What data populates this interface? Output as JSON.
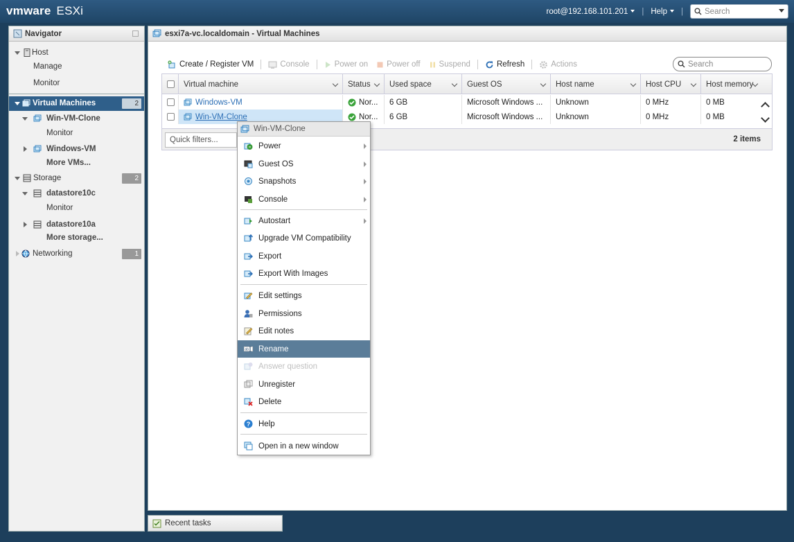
{
  "app": {
    "brand_vm": "vmware",
    "brand_product": "ESXi"
  },
  "topbar": {
    "user": "root@192.168.101.201",
    "help": "Help",
    "search_placeholder": "Search"
  },
  "navigator": {
    "title": "Navigator",
    "host": "Host",
    "manage": "Manage",
    "monitor": "Monitor",
    "vms": {
      "label": "Virtual Machines",
      "count": "2"
    },
    "vm1": "Win-VM-Clone",
    "vm1_monitor": "Monitor",
    "vm2": "Windows-VM",
    "more_vms": "More VMs...",
    "storage": {
      "label": "Storage",
      "count": "2"
    },
    "ds1": "datastore10c",
    "ds1_monitor": "Monitor",
    "ds2": "datastore10a",
    "more_storage": "More storage...",
    "networking": {
      "label": "Networking",
      "count": "1"
    }
  },
  "main": {
    "title": "esxi7a-vc.localdomain - Virtual Machines",
    "toolbar": {
      "create": "Create / Register VM",
      "console": "Console",
      "power_on": "Power on",
      "power_off": "Power off",
      "suspend": "Suspend",
      "refresh": "Refresh",
      "actions": "Actions"
    },
    "search_placeholder": "Search",
    "columns": [
      "Virtual machine",
      "Status",
      "Used space",
      "Guest OS",
      "Host name",
      "Host CPU",
      "Host memory"
    ],
    "rows": [
      {
        "name": "Windows-VM",
        "status": "Nor...",
        "used": "6 GB",
        "guest": "Microsoft Windows ...",
        "host": "Unknown",
        "cpu": "0 MHz",
        "mem": "0 MB"
      },
      {
        "name": "Win-VM-Clone",
        "status": "Nor...",
        "used": "6 GB",
        "guest": "Microsoft Windows ...",
        "host": "Unknown",
        "cpu": "0 MHz",
        "mem": "0 MB"
      }
    ],
    "quick_filters": "Quick filters...",
    "items_count": "2 items"
  },
  "context_menu": {
    "title": "Win-VM-Clone",
    "items": [
      "Power",
      "Guest OS",
      "Snapshots",
      "Console",
      "Autostart",
      "Upgrade VM Compatibility",
      "Export",
      "Export With Images",
      "Edit settings",
      "Permissions",
      "Edit notes",
      "Rename",
      "Answer question",
      "Unregister",
      "Delete",
      "Help",
      "Open in a new window"
    ]
  },
  "recent_tasks": "Recent tasks",
  "colors": {
    "topbar": "#1f4566",
    "selected_nav": "#2f5f8a",
    "menu_highlight": "#5b7d99",
    "link": "#2b6eb5"
  }
}
